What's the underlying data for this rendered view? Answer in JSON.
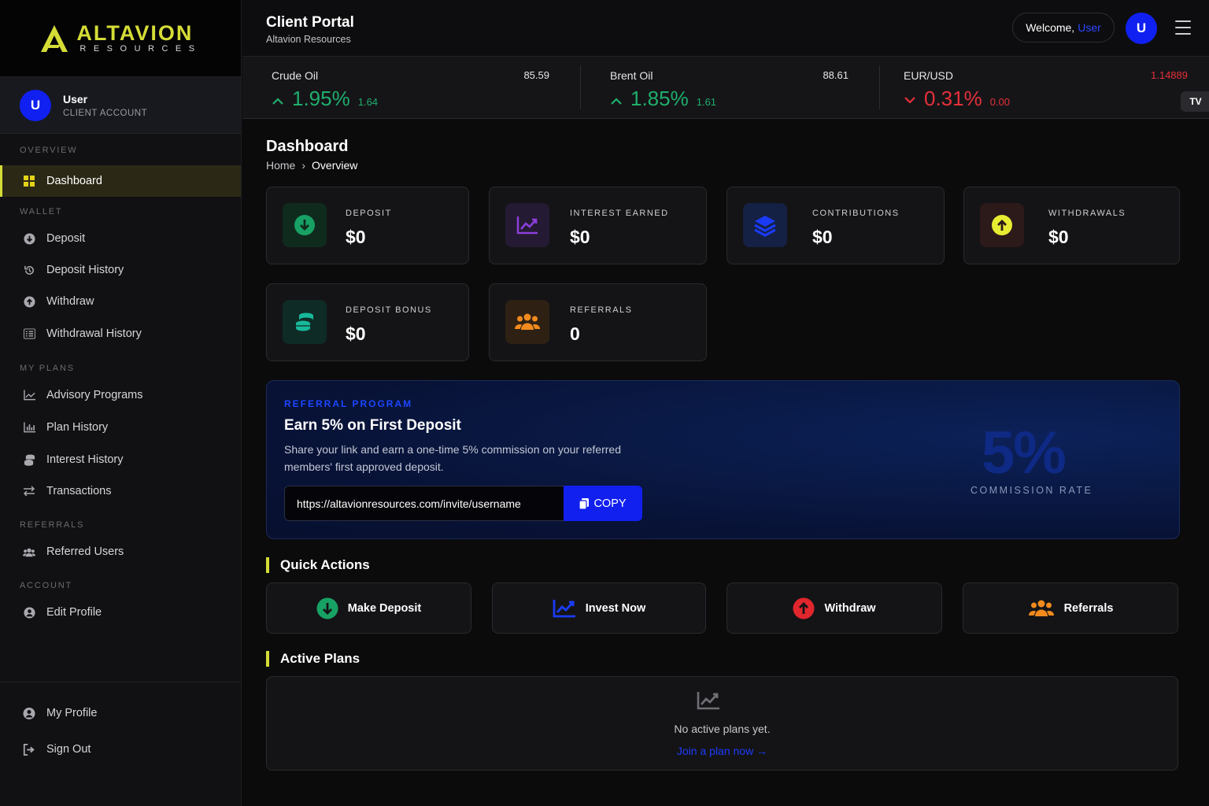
{
  "brand": {
    "name": "ALTAVION",
    "tagline": "RESOURCES"
  },
  "sidebar": {
    "user": {
      "initial": "U",
      "name": "User",
      "role": "CLIENT ACCOUNT"
    },
    "sections": {
      "overview": "OVERVIEW",
      "wallet": "WALLET",
      "plans": "MY PLANS",
      "referrals": "REFERRALS",
      "account": "ACCOUNT"
    },
    "items": {
      "dashboard": "Dashboard",
      "deposit": "Deposit",
      "deposit_history": "Deposit History",
      "withdraw": "Withdraw",
      "withdrawal_history": "Withdrawal History",
      "advisory": "Advisory Programs",
      "plan_history": "Plan History",
      "interest_history": "Interest History",
      "transactions": "Transactions",
      "referred_users": "Referred Users",
      "edit_profile": "Edit Profile",
      "my_profile": "My Profile",
      "sign_out": "Sign Out"
    }
  },
  "header": {
    "title": "Client Portal",
    "subtitle": "Altavion Resources",
    "welcome": "Welcome,",
    "welcome_user": "User",
    "avatar_initial": "U"
  },
  "ticker": [
    {
      "name": "Crude Oil",
      "price": "85.59",
      "change_pct": "1.95%",
      "change": "1.64",
      "direction": "up"
    },
    {
      "name": "Brent Oil",
      "price": "88.61",
      "change_pct": "1.85%",
      "change": "1.61",
      "direction": "up"
    },
    {
      "name": "EUR/USD",
      "price": "1.14889",
      "change_pct": "0.31%",
      "change": "0.00",
      "direction": "down"
    }
  ],
  "ticker_badge": "TV",
  "page": {
    "title": "Dashboard",
    "breadcrumb": {
      "home": "Home",
      "sep": "›",
      "current": "Overview"
    }
  },
  "stats": {
    "deposit": {
      "label": "DEPOSIT",
      "value": "$0"
    },
    "interest": {
      "label": "INTEREST EARNED",
      "value": "$0"
    },
    "contributions": {
      "label": "CONTRIBUTIONS",
      "value": "$0"
    },
    "withdrawals": {
      "label": "WITHDRAWALS",
      "value": "$0"
    },
    "deposit_bonus": {
      "label": "DEPOSIT BONUS",
      "value": "$0"
    },
    "referrals": {
      "label": "REFERRALS",
      "value": "0"
    }
  },
  "referral": {
    "kicker": "REFERRAL PROGRAM",
    "title": "Earn 5% on First Deposit",
    "description": "Share your link and earn a one-time 5% commission on your referred members' first approved deposit.",
    "link": "https://altavionresources.com/invite/username",
    "copy_label": "COPY",
    "rate": "5%",
    "rate_label": "COMMISSION RATE"
  },
  "quick_actions": {
    "title": "Quick Actions",
    "make_deposit": "Make Deposit",
    "invest_now": "Invest Now",
    "withdraw": "Withdraw",
    "referrals": "Referrals"
  },
  "active_plans": {
    "title": "Active Plans",
    "empty": "No active plans yet.",
    "link": "Join a plan now →"
  },
  "colors": {
    "accent": "#d5dc36",
    "primary_blue": "#1120ee",
    "up": "#1fae6c",
    "down": "#e5303a"
  }
}
